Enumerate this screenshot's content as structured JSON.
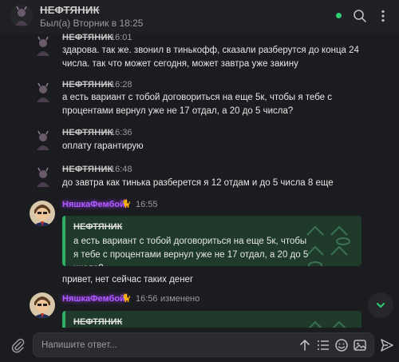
{
  "header": {
    "title": "НЕФТЯНИК",
    "status": "Был(а) Вторник в 18:25"
  },
  "messages": [
    {
      "sender": "НЕФТЯНИК",
      "time": "16:01",
      "text": "здарова. так же. звонил в тинькофф, сказали разберутся до конца 24 числа. так что может сегодня, может завтра уже закину"
    },
    {
      "sender": "НЕФТЯНИК",
      "time": "16:28",
      "text": "а есть вариант с тобой договориться на еще 5к, чтобы я тебе с процентами вернул уже не 17 отдал, а 20 до 5 числа?"
    },
    {
      "sender": "НЕФТЯНИК",
      "time": "16:36",
      "text": "оплату гарантирую"
    },
    {
      "sender": "НЕФТЯНИК",
      "time": "16:48",
      "text": "до завтра как тинька разберется я 12 отдам и до 5 числа 8 еще"
    }
  ],
  "reply1": {
    "sender": "НяшкаФембой",
    "badge": "🐈",
    "time": "16:55",
    "quote_author": "НЕФТЯНИК",
    "quote_text": "а есть вариант с тобой договориться на еще 5к, чтобы я тебе с процентами вернул уже не 17 отдал, а 20 до 5 числа?",
    "text": "привет, нет сейчас таких денег"
  },
  "reply2": {
    "sender": "НяшкаФембой",
    "badge": "🐈",
    "time": "16:56",
    "edited": "изменено",
    "quote_author": "НЕФТЯНИК"
  },
  "composer": {
    "placeholder": "Напишите ответ..."
  },
  "colors": {
    "accent": "#2ecc71",
    "quote_bg": "#1f3a2a",
    "username_purple": "#b05bff"
  }
}
